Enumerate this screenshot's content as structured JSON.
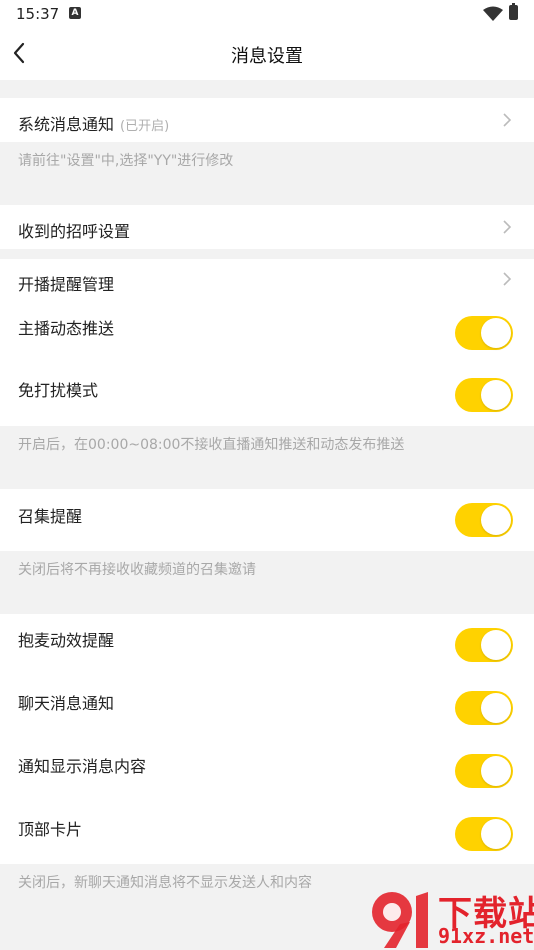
{
  "status_bar": {
    "time": "15:37",
    "notification_icon_letter": "A"
  },
  "header": {
    "title": "消息设置"
  },
  "system_notification": {
    "label": "系统消息通知",
    "status": "(已开启)",
    "tip": "请前往\"设置\"中,选择\"YY\"进行修改"
  },
  "received_greeting": {
    "label": "收到的招呼设置"
  },
  "live_reminder": {
    "label": "开播提醒管理"
  },
  "toggles_group_1": [
    {
      "label": "主播动态推送",
      "on": true
    },
    {
      "label": "免打扰模式",
      "on": true
    }
  ],
  "dnd_tip": "开启后，在00:00~08:00不接收直播通知推送和动态发布推送",
  "summon": {
    "label": "召集提醒",
    "on": true,
    "tip": "关闭后将不再接收收藏频道的召集邀请"
  },
  "toggles_group_2": [
    {
      "label": "抱麦动效提醒",
      "on": true
    },
    {
      "label": "聊天消息通知",
      "on": true
    },
    {
      "label": "通知显示消息内容",
      "on": true
    },
    {
      "label": "顶部卡片",
      "on": true
    }
  ],
  "bottom_tip": "关闭后，新聊天通知消息将不显示发送人和内容",
  "watermark": {
    "top": "下载站",
    "bottom": "91xz.net"
  },
  "colors": {
    "accent": "#ffd200",
    "background": "#f2f2f2",
    "tip": "#a8a8a8",
    "watermark": "#e3232c"
  }
}
